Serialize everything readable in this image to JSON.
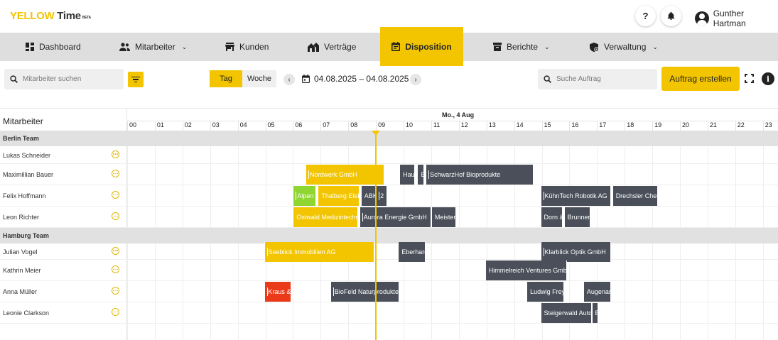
{
  "app": {
    "logo_brand": "YELL",
    "logo_o": "O",
    "logo_w": "W",
    "logo_time": "Time",
    "logo_beta": "BETA",
    "help_label": "?",
    "user_name": "Gunther Hartman"
  },
  "nav": {
    "dashboard": "Dashboard",
    "mitarbeiter": "Mitarbeiter",
    "kunden": "Kunden",
    "vertraege": "Verträge",
    "disposition": "Disposition",
    "berichte": "Berichte",
    "verwaltung": "Verwaltung",
    "chevron": "⌄"
  },
  "toolbar": {
    "employee_search_placeholder": "Mitarbeiter suchen",
    "view_day": "Tag",
    "view_week": "Woche",
    "prev": "‹",
    "next": "›",
    "date_range": "04.08.2025 – 04.08.2025",
    "job_search_placeholder": "Suche Auftrag",
    "create_button": "Auftrag erstellen",
    "info": "i"
  },
  "scheduler": {
    "employee_column_header": "Mitarbeiter",
    "date_header": "Mo., 4 Aug",
    "hours": [
      "00",
      "01",
      "02",
      "03",
      "04",
      "05",
      "06",
      "07",
      "08",
      "09",
      "10",
      "11",
      "12",
      "13",
      "14",
      "15",
      "16",
      "17",
      "18",
      "19",
      "20",
      "21",
      "22",
      "23"
    ],
    "current_time_hour": 9.0,
    "groups": [
      {
        "name": "Berlin Team",
        "employees": [
          {
            "name": "Lukas Schneider",
            "jobs": []
          },
          {
            "name": "Maximillian Bauer",
            "jobs": [
              {
                "label": "Nordwerk GmbH",
                "start": 6.45,
                "end": 9.3,
                "color": "yellow"
              },
              {
                "label": "Hau",
                "start": 9.85,
                "end": 10.4,
                "color": "dark"
              },
              {
                "label": "B",
                "start": 10.5,
                "end": 10.75,
                "color": "dark"
              },
              {
                "label": "SchwarzHof Bioprodukte",
                "start": 10.8,
                "end": 14.7,
                "color": "dark"
              }
            ]
          },
          {
            "name": "Felix Hoffmann",
            "jobs": [
              {
                "label": "Alpen",
                "start": 6.0,
                "end": 6.85,
                "color": "green"
              },
              {
                "label": "Thalberg Elektro",
                "start": 6.9,
                "end": 8.4,
                "color": "yellow"
              },
              {
                "label": "ABK",
                "start": 8.45,
                "end": 9.0,
                "color": "dark"
              },
              {
                "label": "2",
                "start": 9.0,
                "end": 9.4,
                "color": "dark"
              },
              {
                "label": "KühnTech Robotik AG",
                "start": 14.95,
                "end": 17.5,
                "color": "dark"
              },
              {
                "label": "Drechsler Chemie",
                "start": 17.55,
                "end": 19.2,
                "color": "dark"
              }
            ]
          },
          {
            "name": "Leon Richter",
            "jobs": [
              {
                "label": "Ostwald Medizintechnik",
                "start": 6.0,
                "end": 8.35,
                "color": "yellow"
              },
              {
                "label": "Aurora Energie GmbH",
                "start": 8.4,
                "end": 11.0,
                "color": "dark"
              },
              {
                "label": "Meister",
                "start": 11.0,
                "end": 11.9,
                "color": "dark"
              },
              {
                "label": "Dorn &",
                "start": 14.95,
                "end": 15.75,
                "color": "dark"
              },
              {
                "label": "Brunner",
                "start": 15.8,
                "end": 16.75,
                "color": "dark"
              }
            ]
          }
        ]
      },
      {
        "name": "Hamburg Team",
        "employees": [
          {
            "name": "Julian Vogel",
            "jobs": [
              {
                "label": "Seeblick Immobilien AG",
                "start": 4.95,
                "end": 8.95,
                "color": "yellow"
              },
              {
                "label": "Eberhardt",
                "start": 9.8,
                "end": 10.8,
                "color": "dark"
              },
              {
                "label": "Klarblick Optik GmbH",
                "start": 14.95,
                "end": 17.5,
                "color": "dark"
              }
            ]
          },
          {
            "name": "Kathrin Meier",
            "jobs": [
              {
                "label": "Himmelreich Ventures GmbH",
                "start": 12.95,
                "end": 15.9,
                "color": "dark"
              }
            ]
          },
          {
            "name": "Anna Müller",
            "jobs": [
              {
                "label": "Kraus &",
                "start": 4.95,
                "end": 5.95,
                "color": "red"
              },
              {
                "label": "BioFeld Naturprodukte",
                "start": 7.35,
                "end": 9.85,
                "color": "dark"
              },
              {
                "label": "Ludwig Frey",
                "start": 14.45,
                "end": 15.8,
                "color": "dark"
              },
              {
                "label": "Augenarzt",
                "start": 16.5,
                "end": 17.5,
                "color": "dark"
              }
            ]
          },
          {
            "name": "Leonie Clarkson",
            "jobs": [
              {
                "label": "Steigerwald Automation",
                "start": 14.95,
                "end": 16.8,
                "color": "dark"
              },
              {
                "label": "B",
                "start": 16.8,
                "end": 17.05,
                "color": "dark"
              }
            ]
          }
        ]
      }
    ]
  }
}
